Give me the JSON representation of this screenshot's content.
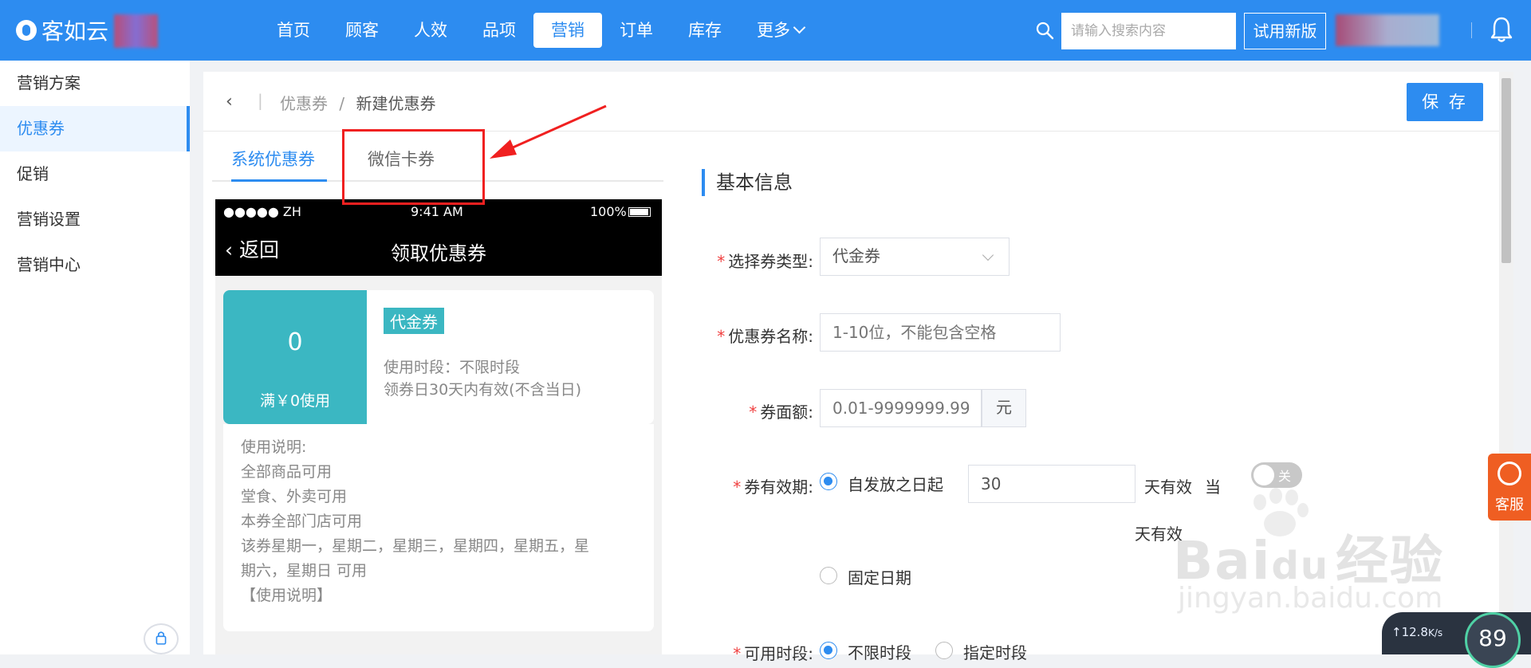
{
  "header": {
    "brand": "客如云",
    "nav": [
      "首页",
      "顾客",
      "人效",
      "品项",
      "营销",
      "订单",
      "库存",
      "更多"
    ],
    "active_nav": "营销",
    "search_placeholder": "请输入搜索内容",
    "try_new_label": "试用新版"
  },
  "sidebar": {
    "items": [
      "营销方案",
      "优惠券",
      "促销",
      "营销设置",
      "营销中心"
    ],
    "active": "优惠券"
  },
  "breadcrumb": {
    "parent": "优惠券",
    "separator": "/",
    "current": "新建优惠券",
    "save_label": "保 存"
  },
  "tabs": {
    "system": "系统优惠券",
    "wechat": "微信卡券"
  },
  "preview": {
    "status_signal": "●●●●● ZH",
    "status_time": "9:41 AM",
    "status_battery": "100%",
    "back_label": "返回",
    "title": "领取优惠券",
    "amount": "0",
    "condition": "满￥0使用",
    "tag": "代金券",
    "time_range": "使用时段：不限时段",
    "validity": "领券日30天内有效(不含当日)",
    "usage": [
      "使用说明:",
      "全部商品可用",
      "堂食、外卖可用",
      "本券全部门店可用",
      "该券星期一，星期二，星期三，星期四，星期五，星",
      "期六，星期日 可用",
      "【使用说明】"
    ]
  },
  "form": {
    "section": "基本信息",
    "type_label": "选择券类型:",
    "type_value": "代金券",
    "name_label": "优惠券名称:",
    "name_placeholder": "1-10位，不能包含空格",
    "amount_label": "券面额:",
    "amount_placeholder": "0.01-9999999.99",
    "amount_unit": "元",
    "validity_label": "券有效期:",
    "validity_option1": "自发放之日起",
    "validity_days": "30",
    "validity_suffix": "天有效",
    "validity_sameday_a": "当",
    "validity_sameday_b": "天有效",
    "validity_switch": "关",
    "validity_option2": "固定日期",
    "period_label": "可用时段:",
    "period_option1": "不限时段",
    "period_option2": "指定时段"
  },
  "widgets": {
    "service_label": "客服",
    "speed": "12.8",
    "speed_unit": "K/s",
    "percent": "89"
  },
  "watermark": {
    "line1": "Bai",
    "line1b": "du",
    "line1c": "经验",
    "line2": "jingyan.baidu.com"
  },
  "colors": {
    "primary": "#2d8cf0",
    "accent": "#3bb7c2",
    "highlight": "#f02020"
  }
}
